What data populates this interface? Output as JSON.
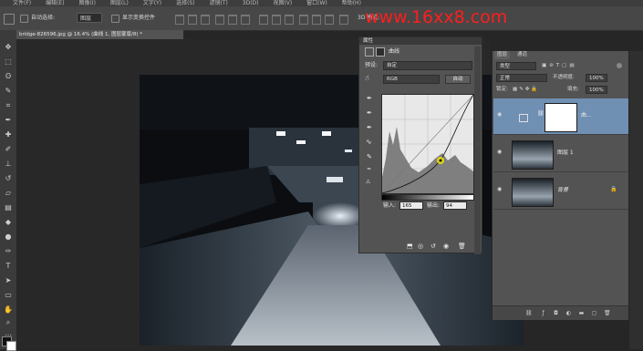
{
  "menubar": {
    "items": [
      "文件(F)",
      "编辑(E)",
      "图像(I)",
      "图层(L)",
      "文字(Y)",
      "选择(S)",
      "滤镜(T)",
      "3D(D)",
      "视图(V)",
      "窗口(W)",
      "帮助(H)"
    ]
  },
  "options_bar": {
    "auto_select_label": "自动选择:",
    "auto_select_value": "图层",
    "show_transform_label": "显示变换控件",
    "mode_3d_label": "3D 模式:",
    "watermark": "www.16xx8.com"
  },
  "document": {
    "tab_title": "bridge-826596.jpg @ 16.4% (曲线 1, 图层蒙版/8) *"
  },
  "properties": {
    "title": "属性",
    "panel_name": "曲线",
    "preset_label": "预设:",
    "preset_value": "自定",
    "channel_value": "RGB",
    "auto_button": "自动",
    "input_label": "输入:",
    "input_value": "165",
    "output_label": "输出:",
    "output_value": "94"
  },
  "layers": {
    "tab_layers": "图层",
    "tab_channels": "通道",
    "kind_value": "类型",
    "blend_mode": "正常",
    "opacity_label": "不透明度:",
    "opacity_value": "100%",
    "lock_label": "锁定:",
    "fill_label": "填充:",
    "fill_value": "100%",
    "items": [
      {
        "name": "曲..."
      },
      {
        "name": "图层 1"
      },
      {
        "name": "背景"
      }
    ]
  },
  "colors": {
    "accent_selected_layer": "#6f8fb3",
    "watermark": "#ff1d1d"
  }
}
